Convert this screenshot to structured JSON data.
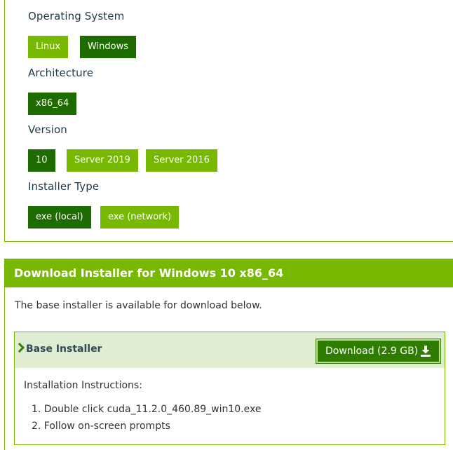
{
  "selector": {
    "os": {
      "heading": "Operating System",
      "options": [
        {
          "label": "Linux",
          "selected": false
        },
        {
          "label": "Windows",
          "selected": true
        }
      ]
    },
    "arch": {
      "heading": "Architecture",
      "options": [
        {
          "label": "x86_64",
          "selected": true
        }
      ]
    },
    "version": {
      "heading": "Version",
      "options": [
        {
          "label": "10",
          "selected": true
        },
        {
          "label": "Server 2019",
          "selected": false
        },
        {
          "label": "Server 2016",
          "selected": false
        }
      ]
    },
    "installer_type": {
      "heading": "Installer Type",
      "options": [
        {
          "label": "exe (local)",
          "selected": true
        },
        {
          "label": "exe (network)",
          "selected": false
        }
      ]
    }
  },
  "download": {
    "header": "Download Installer for Windows 10 x86_64",
    "description": "The base installer is available for download below.",
    "base_installer": {
      "title": "Base Installer",
      "button_label": "Download (2.9 GB)",
      "instructions_title": "Installation Instructions:",
      "steps": [
        "1. Double click cuda_11.2.0_460.89_win10.exe",
        "2. Follow on-screen prompts"
      ]
    }
  },
  "colors": {
    "accent": "#76b900",
    "selected": "#1e6b00",
    "installer_header_bg": "#dfeed2",
    "download_button": "#2e7d00"
  },
  "icons": {
    "expand": "chevron-right-icon",
    "download": "download-icon"
  }
}
